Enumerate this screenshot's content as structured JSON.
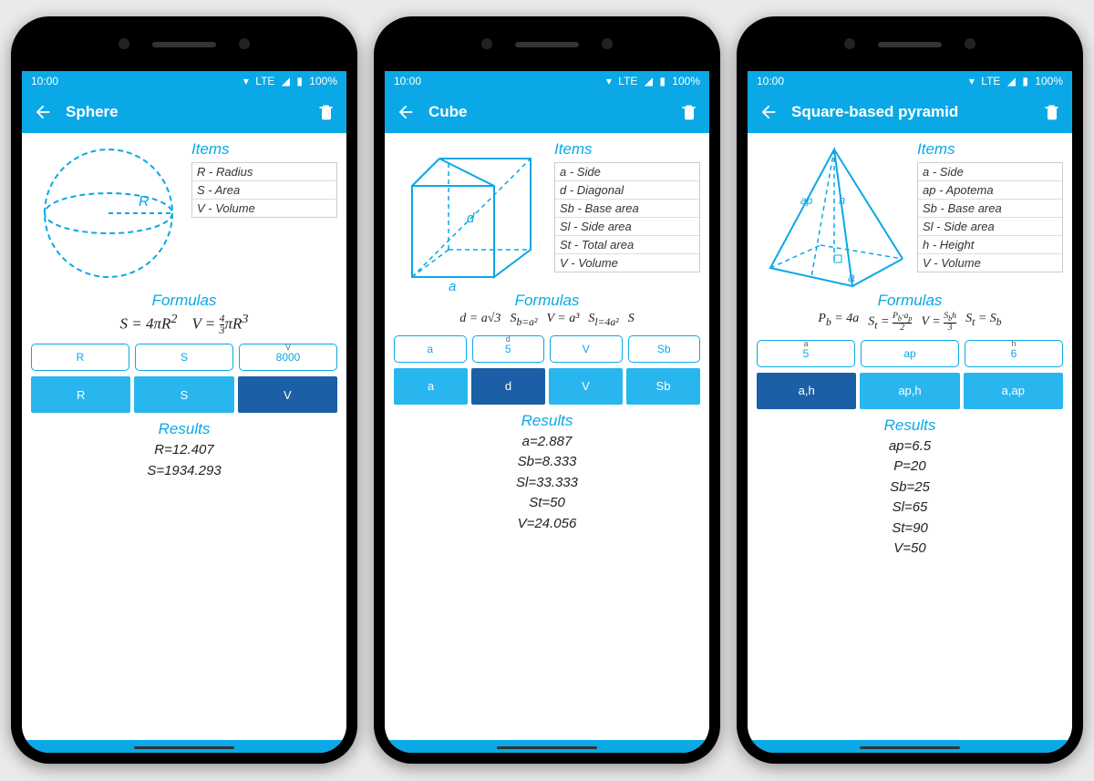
{
  "status": {
    "time": "10:00",
    "net": "LTE",
    "bat": "100%"
  },
  "screens": [
    {
      "title": "Sphere",
      "items_title": "Items",
      "items": [
        "R - Radius",
        "S - Area",
        "V - Volume"
      ],
      "formulas_title": "Formulas",
      "formulas": [
        "S = 4πR²",
        "V = ⁴⁄₃πR³"
      ],
      "inputs": [
        {
          "top": "",
          "label": "R"
        },
        {
          "top": "",
          "label": "S"
        },
        {
          "top": "V",
          "label": "8000"
        }
      ],
      "tabs": [
        "R",
        "S",
        "V"
      ],
      "tab_active": 2,
      "results_title": "Results",
      "results": [
        "R=12.407",
        "S=1934.293"
      ]
    },
    {
      "title": "Cube",
      "items_title": "Items",
      "items": [
        "a - Side",
        "d - Diagonal",
        "Sb - Base area",
        "Sl - Side area",
        "St - Total area",
        "V - Volume"
      ],
      "formulas_title": "Formulas",
      "formulas": [
        "d = a√3",
        "S_b = a²",
        "V = a³",
        "S_l = 4a²",
        "S"
      ],
      "inputs": [
        {
          "top": "",
          "label": "a"
        },
        {
          "top": "d",
          "label": "5"
        },
        {
          "top": "",
          "label": "V"
        },
        {
          "top": "",
          "label": "Sb"
        }
      ],
      "tabs": [
        "a",
        "d",
        "V",
        "Sb"
      ],
      "tab_active": 1,
      "results_title": "Results",
      "results": [
        "a=2.887",
        "Sb=8.333",
        "Sl=33.333",
        "St=50",
        "V=24.056"
      ]
    },
    {
      "title": "Square-based pyramid",
      "items_title": "Items",
      "items": [
        "a - Side",
        "ap - Apotema",
        "Sb - Base area",
        "Sl - Side area",
        "h - Height",
        "V - Volume"
      ],
      "formulas_title": "Formulas",
      "formulas": [
        "P_b = 4a",
        "S_t = P_b·a_p / 2",
        "V = S_b·h / 3",
        "S_t = S_b"
      ],
      "inputs": [
        {
          "top": "a",
          "label": "5"
        },
        {
          "top": "",
          "label": "ap"
        },
        {
          "top": "h",
          "label": "6"
        }
      ],
      "tabs": [
        "a,h",
        "ap,h",
        "a,ap"
      ],
      "tab_active": 0,
      "results_title": "Results",
      "results": [
        "ap=6.5",
        "P=20",
        "Sb=25",
        "Sl=65",
        "St=90",
        "V=50"
      ]
    }
  ]
}
